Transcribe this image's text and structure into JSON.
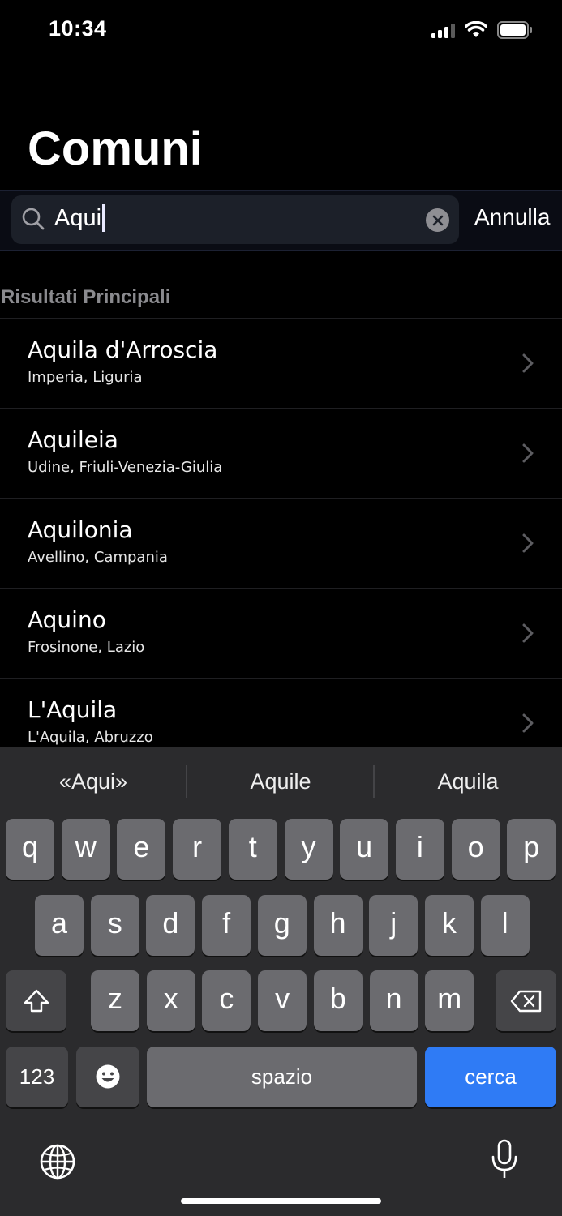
{
  "status": {
    "time": "10:34"
  },
  "header": {
    "title": "Comuni"
  },
  "search": {
    "value": "Aqui",
    "cancel_label": "Annulla"
  },
  "results": {
    "section_title": "Risultati Principali",
    "items": [
      {
        "name": "Aquila d'Arroscia",
        "region": "Imperia, Liguria"
      },
      {
        "name": "Aquileia",
        "region": "Udine, Friuli-Venezia-Giulia"
      },
      {
        "name": "Aquilonia",
        "region": "Avellino, Campania"
      },
      {
        "name": "Aquino",
        "region": "Frosinone, Lazio"
      },
      {
        "name": "L'Aquila",
        "region": "L'Aquila, Abruzzo"
      }
    ]
  },
  "keyboard": {
    "suggestions": [
      "«Aqui»",
      "Aquile",
      "Aquila"
    ],
    "row1": [
      "q",
      "w",
      "e",
      "r",
      "t",
      "y",
      "u",
      "i",
      "o",
      "p"
    ],
    "row2": [
      "a",
      "s",
      "d",
      "f",
      "g",
      "h",
      "j",
      "k",
      "l"
    ],
    "row3": [
      "z",
      "x",
      "c",
      "v",
      "b",
      "n",
      "m"
    ],
    "numbers_label": "123",
    "space_label": "spazio",
    "search_label": "cerca"
  },
  "colors": {
    "accent": "#2f7bf5",
    "keyboard_bg": "#2b2b2d",
    "key": "#6b6b6f",
    "key_dark": "#454548"
  },
  "icons": [
    "search-icon",
    "clear-icon",
    "chevron-right-icon",
    "shift-icon",
    "delete-icon",
    "emoji-icon",
    "globe-icon",
    "microphone-icon",
    "signal-icon",
    "wifi-icon",
    "battery-icon"
  ]
}
